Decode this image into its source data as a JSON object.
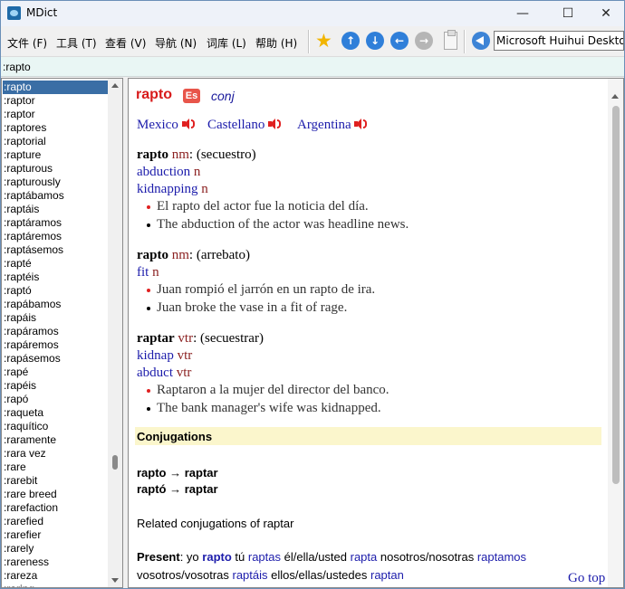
{
  "window": {
    "title": "MDict",
    "minimize": "—",
    "maximize": "☐",
    "close": "✕"
  },
  "menu": [
    "文件 (F)",
    "工具 (T)",
    "查看 (V)",
    "导航 (N)",
    "词库 (L)",
    "帮助 (H)"
  ],
  "toolbar": {
    "voice": "Microsoft Huihui Desktop"
  },
  "search": {
    "value": ":rapto"
  },
  "wordlist": [
    ":rapto",
    ":raptor",
    ":raptor",
    ":raptores",
    ":raptorial",
    ":rapture",
    ":rapturous",
    ":rapturously",
    ":raptábamos",
    ":raptáis",
    ":raptáramos",
    ":raptáremos",
    ":raptásemos",
    ":rapté",
    ":raptéis",
    ":raptó",
    ":rapábamos",
    ":rapáis",
    ":rapáramos",
    ":rapáremos",
    ":rapásemos",
    ":rapé",
    ":rapéis",
    ":rapó",
    ":raqueta",
    ":raquítico",
    ":raramente",
    ":rara vez",
    ":rare",
    ":rarebit",
    ":rare breed",
    ":rarefaction",
    ":rarefied",
    ":rarefier",
    ":rarely",
    ":rareness",
    ":rareza",
    ":raring"
  ],
  "entry": {
    "headword": "rapto",
    "lang_badge": "Es",
    "pos": "conj",
    "accents": [
      "Mexico",
      "Castellano",
      "Argentina"
    ],
    "senses": [
      {
        "word": "rapto",
        "pos": "nm",
        "gloss": ": (secuestro)",
        "translations": [
          {
            "word": "abduction",
            "pos": "n"
          },
          {
            "word": "kidnapping",
            "pos": "n"
          }
        ],
        "examples": [
          "El rapto del actor fue la noticia del día.",
          "The abduction of the actor was headline news."
        ]
      },
      {
        "word": "rapto",
        "pos": "nm",
        "gloss": ": (arrebato)",
        "translations": [
          {
            "word": "fit",
            "pos": "n"
          }
        ],
        "examples": [
          "Juan rompió el jarrón en un rapto de ira.",
          "Juan broke the vase in a fit of rage."
        ]
      },
      {
        "word": "raptar",
        "pos": "vtr",
        "gloss": ": (secuestrar)",
        "translations": [
          {
            "word": "kidnap",
            "pos": "vtr"
          },
          {
            "word": "abduct",
            "pos": "vtr"
          }
        ],
        "examples": [
          "Raptaron a la mujer del director del banco.",
          "The bank manager's wife was kidnapped."
        ]
      }
    ],
    "conjugations_heading": "Conjugations",
    "conj_lines": [
      "rapto → raptar",
      "raptó → raptar"
    ],
    "related": "Related conjugations of raptar",
    "present": {
      "label": "Present",
      "parts": [
        {
          "p": ": yo ",
          "f": "rapto"
        },
        {
          "p": " tú ",
          "f": "raptas"
        },
        {
          "p": " él/ella/usted ",
          "f": "rapta"
        },
        {
          "p": " nosotros/nosotras ",
          "f": "raptamos"
        }
      ],
      "parts2": [
        {
          "p": "vosotros/vosotras ",
          "f": "raptáis"
        },
        {
          "p": " ellos/ellas/ustedes ",
          "f": "raptan"
        }
      ]
    },
    "go_top": "Go top"
  },
  "colors": {
    "selection": "#3a6ea5",
    "headword": "#d81b1b",
    "translation": "#1c1cab",
    "pos": "#8b2020",
    "conj_band": "#fbf6cc"
  }
}
